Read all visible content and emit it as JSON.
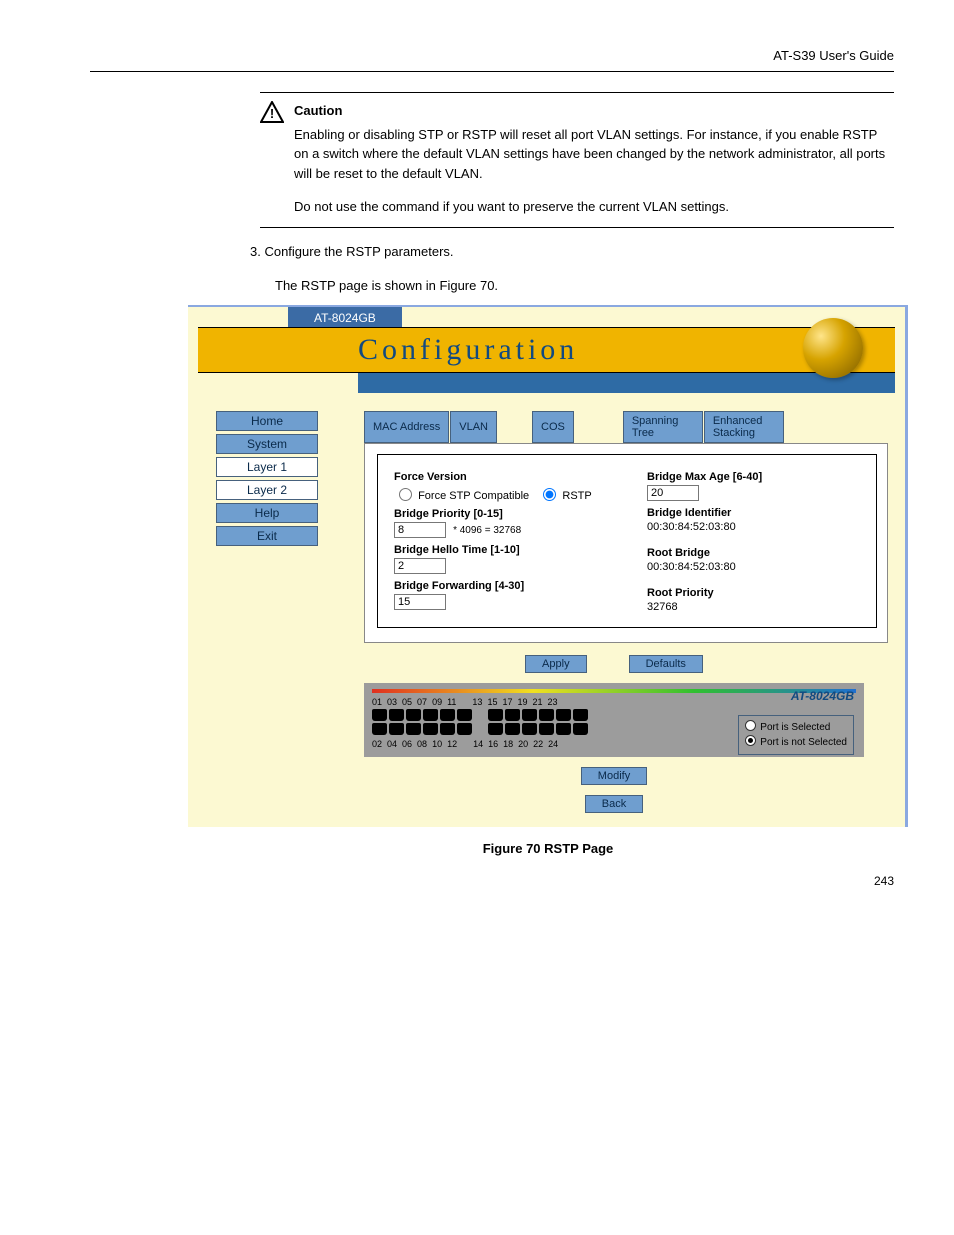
{
  "header": {
    "guide_title": "AT-S39 User's Guide"
  },
  "caution": {
    "heading": "Caution",
    "para1": "Enabling or disabling STP or RSTP will reset all port VLAN settings. For instance, if you enable RSTP on a switch where the default VLAN settings have been changed by the network administrator, all ports will be reset to the default VLAN.",
    "para2": "Do not use the command if you want to preserve the current VLAN settings."
  },
  "step3": "3.  Configure the RSTP parameters.",
  "step_ref": "The RSTP page is shown in Figure 70.",
  "figure_caption": "Figure 70   RSTP Page",
  "page_number": "243",
  "ui": {
    "model_tab": "AT-8024GB",
    "title": "Configuration",
    "sidebar": {
      "home": "Home",
      "system": "System",
      "layer1": "Layer 1",
      "layer2": "Layer 2",
      "help": "Help",
      "exit": "Exit"
    },
    "tabs": {
      "mac": "MAC Address",
      "vlan": "VLAN",
      "cos": "COS",
      "stp": "Spanning\nTree",
      "enh": "Enhanced\nStacking"
    },
    "form": {
      "force_version_label": "Force Version",
      "force_stp_label": "Force STP Compatible",
      "rstp_label": "RSTP",
      "bridge_priority_label": "Bridge Priority [0-15]",
      "bridge_priority_value": "8",
      "bridge_priority_calc": "* 4096 = 32768",
      "bridge_hello_label": "Bridge Hello Time [1-10]",
      "bridge_hello_value": "2",
      "bridge_fwd_label": "Bridge Forwarding [4-30]",
      "bridge_fwd_value": "15",
      "bridge_maxage_label": "Bridge Max Age [6-40]",
      "bridge_maxage_value": "20",
      "bridge_id_label": "Bridge Identifier",
      "bridge_id_value": "00:30:84:52:03:80",
      "root_bridge_label": "Root Bridge",
      "root_bridge_value": "00:30:84:52:03:80",
      "root_priority_label": "Root Priority",
      "root_priority_value": "32768"
    },
    "buttons": {
      "apply": "Apply",
      "defaults": "Defaults",
      "modify": "Modify",
      "back": "Back"
    },
    "switch": {
      "model": "AT-8024GB",
      "top_labels": [
        "01",
        "03",
        "05",
        "07",
        "09",
        "11",
        "13",
        "15",
        "17",
        "19",
        "21",
        "23"
      ],
      "bottom_labels": [
        "02",
        "04",
        "06",
        "08",
        "10",
        "12",
        "14",
        "16",
        "18",
        "20",
        "22",
        "24"
      ],
      "legend_sel": "Port is Selected",
      "legend_nosel": "Port is not Selected"
    }
  }
}
